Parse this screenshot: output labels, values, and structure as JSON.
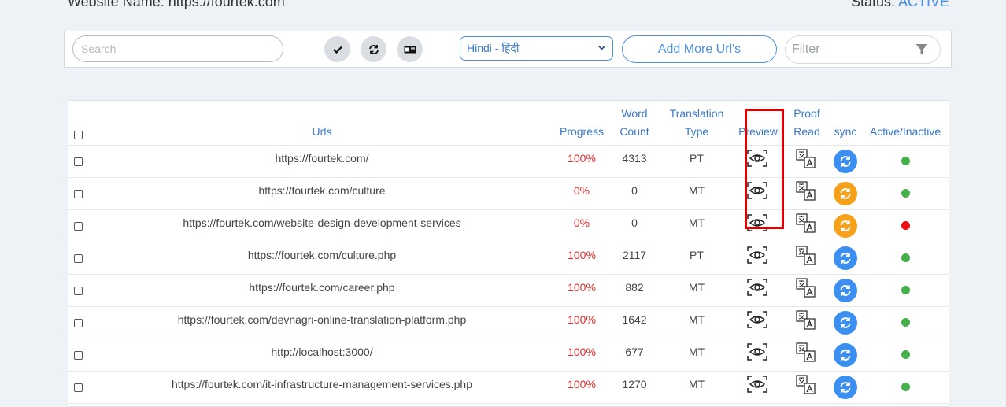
{
  "site": {
    "name_label": "Website Name: https://fourtek.com",
    "status_label": "Status:",
    "status_value": "ACTIVE"
  },
  "toolbar": {
    "search_placeholder": "Search",
    "language": "Hindi - हिंदी",
    "add_more": "Add More Url's",
    "filter_placeholder": "Filter"
  },
  "table": {
    "headers": {
      "urls": "Urls",
      "progress": "Progress",
      "word_count_1": "Word",
      "word_count_2": "Count",
      "type_1": "Translation",
      "type_2": "Type",
      "preview": "Preview",
      "proof_1": "Proof",
      "proof_2": "Read",
      "sync": "sync",
      "active": "Active/Inactive"
    },
    "rows": [
      {
        "url": "https://fourtek.com/",
        "progress": "100%",
        "words": "4313",
        "type": "PT",
        "sync": "blue",
        "active": "green"
      },
      {
        "url": "https://fourtek.com/culture",
        "progress": "0%",
        "words": "0",
        "type": "MT",
        "sync": "orange",
        "active": "green"
      },
      {
        "url": "https://fourtek.com/website-design-development-services",
        "progress": "0%",
        "words": "0",
        "type": "MT",
        "sync": "orange",
        "active": "red"
      },
      {
        "url": "https://fourtek.com/culture.php",
        "progress": "100%",
        "words": "2117",
        "type": "PT",
        "sync": "blue",
        "active": "green"
      },
      {
        "url": "https://fourtek.com/career.php",
        "progress": "100%",
        "words": "882",
        "type": "MT",
        "sync": "blue",
        "active": "green"
      },
      {
        "url": "https://fourtek.com/devnagri-online-translation-platform.php",
        "progress": "100%",
        "words": "1642",
        "type": "MT",
        "sync": "blue",
        "active": "green"
      },
      {
        "url": "http://localhost:3000/",
        "progress": "100%",
        "words": "677",
        "type": "MT",
        "sync": "blue",
        "active": "green"
      },
      {
        "url": "https://fourtek.com/it-infrastructure-management-services.php",
        "progress": "100%",
        "words": "1270",
        "type": "MT",
        "sync": "blue",
        "active": "green"
      }
    ]
  },
  "colors": {
    "accent": "#4a90e2",
    "sync_blue": "#3b8ff0",
    "sync_orange": "#f5a11b",
    "active_green": "#45b04a",
    "inactive_red": "#ee1111",
    "highlight": "#e00000"
  }
}
